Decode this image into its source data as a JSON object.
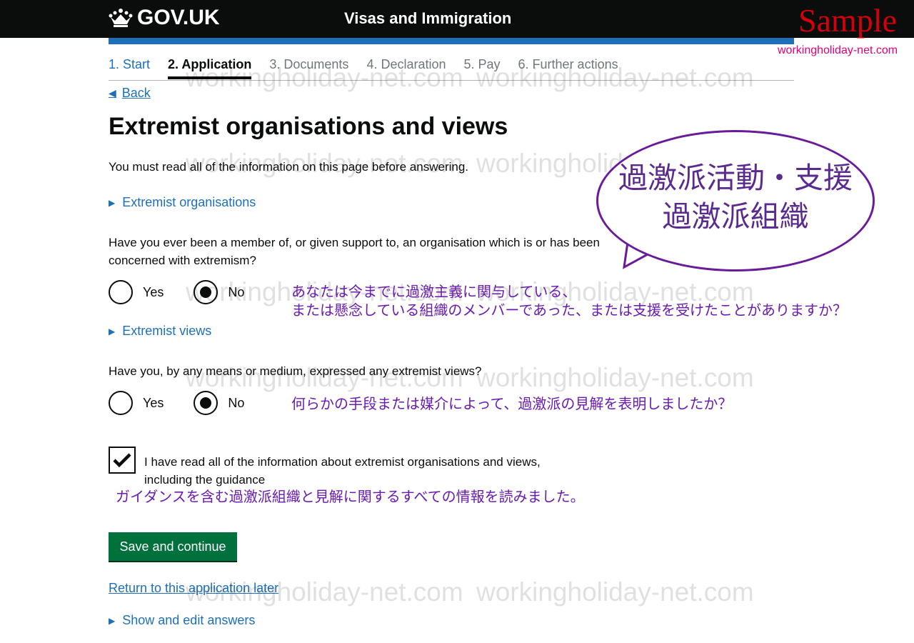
{
  "header": {
    "logo_text": "GOV.UK",
    "service_name": "Visas and Immigration",
    "sample_label": "Sample",
    "sample_url": "workingholiday-net.com"
  },
  "steps": [
    {
      "label": "1. Start",
      "state": "done"
    },
    {
      "label": "2. Application",
      "state": "current"
    },
    {
      "label": "3. Documents",
      "state": "pending"
    },
    {
      "label": "4. Declaration",
      "state": "pending"
    },
    {
      "label": "5. Pay",
      "state": "pending"
    },
    {
      "label": "6. Further actions",
      "state": "pending"
    }
  ],
  "back_label": "Back",
  "page_title": "Extremist organisations and views",
  "intro": "You must read all of the information on this page before answering.",
  "details": {
    "organisations": "Extremist organisations",
    "views": "Extremist views",
    "answers": "Show and edit answers"
  },
  "q1": {
    "text": "Have you ever been a member of, or given support to, an organisation which is or has been concerned with extremism?",
    "yes": "Yes",
    "no": "No",
    "selected": "No"
  },
  "q2": {
    "text": "Have you, by any means or medium, expressed any extremist views?",
    "yes": "Yes",
    "no": "No",
    "selected": "No"
  },
  "confirm": {
    "checked": true,
    "label": "I have read all of the information about extremist organisations and views, including the guidance"
  },
  "save_button": "Save and continue",
  "return_link": "Return to this application later",
  "watermark": "workingholiday-net.com",
  "annotations": {
    "bubble_line1": "過激派活動・支援",
    "bubble_line2": "過激派組織",
    "q1_line1": "あなたは今までに過激主義に関与している、",
    "q1_line2": "または懸念している組織のメンバーであった、または支援を受けたことがありますか？",
    "q2": "何らかの手段または媒介によって、過激派の見解を表明しましたか？",
    "confirm": "ガイダンスを含む過激派組織と見解に関するすべての情報を読みました。"
  },
  "colors": {
    "header_bg": "#0b0c0c",
    "link": "#1d70b8",
    "button": "#00703c",
    "annotation": "#6a1bb0",
    "sample_red": "#d4000b"
  }
}
